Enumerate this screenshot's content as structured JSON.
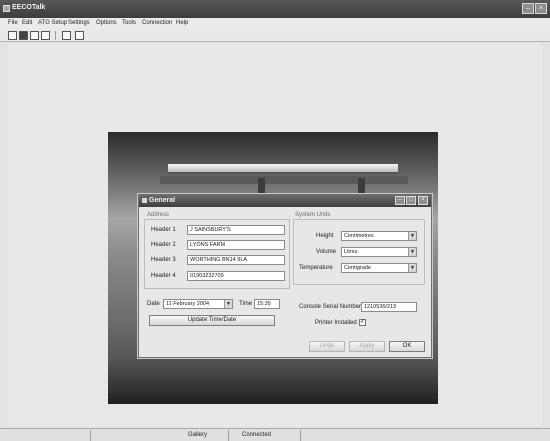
{
  "window": {
    "title": "EECOTalk"
  },
  "menu": [
    "File",
    "Edit",
    "ATG Setup",
    "Settings",
    "Options",
    "Tools",
    "Connection",
    "Help"
  ],
  "toolbar": {
    "icons": [
      "new-icon",
      "save-icon",
      "open-icon",
      "print-icon",
      "cut-icon",
      "copy-icon"
    ]
  },
  "dialog": {
    "title": "General",
    "address": {
      "group_label": "Address",
      "headers": [
        {
          "label": "Header 1",
          "value": "J SAINSBURY'S"
        },
        {
          "label": "Header 2",
          "value": "LYONS FARM"
        },
        {
          "label": "Header 3",
          "value": "WORTHING BN14 9LA"
        },
        {
          "label": "Header 4",
          "value": "01903232709"
        }
      ]
    },
    "date_label": "Date",
    "date": {
      "day": "11",
      "month": "February",
      "year": "2004"
    },
    "time_label": "Time",
    "time_value": "15:35",
    "update_button": "Update Time/Date",
    "system_units": {
      "group_label": "System Units",
      "height_label": "Height",
      "height_value": "Centimetres",
      "volume_label": "Volume",
      "volume_value": "Litres",
      "temperature_label": "Temperature",
      "temperature_value": "Centigrade"
    },
    "console_serial_label": "Console Serial Number",
    "console_serial_value": "1210536/213",
    "printer_label": "Printer Installed",
    "printer_checked": true,
    "buttons": {
      "undo": "Undo",
      "apply": "Apply",
      "ok": "OK"
    }
  },
  "status": {
    "left": "Gallery",
    "right": "Connected"
  }
}
